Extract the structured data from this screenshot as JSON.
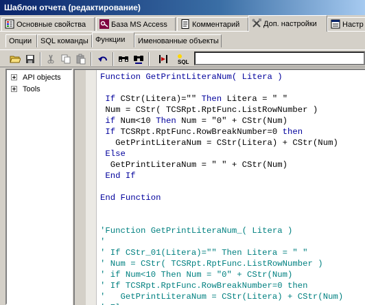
{
  "window": {
    "title": "Шаблон отчета (редактирование)"
  },
  "tabs_main": [
    {
      "label": "Основные свойства",
      "icon": "properties-icon"
    },
    {
      "label": "База MS Access",
      "icon": "database-key-icon"
    },
    {
      "label": "Комментарий",
      "icon": "comment-page-icon"
    },
    {
      "label": "Доп. настройки",
      "icon": "tools-icon"
    },
    {
      "label": "Настр",
      "icon": "settings-page-icon"
    }
  ],
  "tabs_sub": [
    {
      "label": "Опции"
    },
    {
      "label": "SQL команды"
    },
    {
      "label": "Функции"
    },
    {
      "label": "Именованные объекты"
    }
  ],
  "toolbar": {
    "buttons": [
      "open-folder-icon",
      "save-icon",
      "cut-icon",
      "copy-icon",
      "paste-icon",
      "undo-icon",
      "find-icon",
      "find-next-icon",
      "insert-marker-icon",
      "sql-icon"
    ],
    "combo_value": ""
  },
  "tree": {
    "items": [
      {
        "label": "API objects"
      },
      {
        "label": "Tools"
      }
    ]
  },
  "code": {
    "lines": [
      {
        "segments": [
          {
            "t": "Function GetPrintLiteraNum( Litera )",
            "k": "kw"
          }
        ]
      },
      {
        "segments": [
          {
            "t": "",
            "k": ""
          }
        ]
      },
      {
        "segments": [
          {
            "t": " If ",
            "k": "kw"
          },
          {
            "t": "CStr(Litera)=\"\" ",
            "k": ""
          },
          {
            "t": "Then",
            "k": "kw"
          },
          {
            "t": " Litera = \" \"",
            "k": ""
          }
        ]
      },
      {
        "segments": [
          {
            "t": " Num = CStr( TCSRpt.RptFunc.ListRowNumber )",
            "k": ""
          }
        ]
      },
      {
        "segments": [
          {
            "t": " if ",
            "k": "kw"
          },
          {
            "t": "Num<10 ",
            "k": ""
          },
          {
            "t": "Then",
            "k": "kw"
          },
          {
            "t": " Num = \"0\" + CStr(Num)",
            "k": ""
          }
        ]
      },
      {
        "segments": [
          {
            "t": " If ",
            "k": "kw"
          },
          {
            "t": "TCSRpt.RptFunc.RowBreakNumber=0 ",
            "k": ""
          },
          {
            "t": "then",
            "k": "kw"
          }
        ]
      },
      {
        "segments": [
          {
            "t": "   GetPrintLiteraNum = CStr(Litera) + CStr(Num)",
            "k": ""
          }
        ]
      },
      {
        "segments": [
          {
            "t": " Else",
            "k": "kw"
          }
        ]
      },
      {
        "segments": [
          {
            "t": "  GetPrintLiteraNum = \" \" + CStr(Num)",
            "k": ""
          }
        ]
      },
      {
        "segments": [
          {
            "t": " End If",
            "k": "kw"
          }
        ]
      },
      {
        "segments": [
          {
            "t": "",
            "k": ""
          }
        ]
      },
      {
        "segments": [
          {
            "t": "End Function",
            "k": "kw"
          }
        ]
      },
      {
        "segments": [
          {
            "t": "",
            "k": ""
          }
        ]
      },
      {
        "segments": [
          {
            "t": "",
            "k": ""
          }
        ]
      },
      {
        "segments": [
          {
            "t": "'Function GetPrintLiteraNum_( Litera )",
            "k": "cm"
          }
        ]
      },
      {
        "segments": [
          {
            "t": "'",
            "k": "cm"
          }
        ]
      },
      {
        "segments": [
          {
            "t": "' If CStr_01(Litera)=\"\" Then Litera = \" \"",
            "k": "cm"
          }
        ]
      },
      {
        "segments": [
          {
            "t": "' Num = CStr( TCSRpt.RptFunc.ListRowNumber )",
            "k": "cm"
          }
        ]
      },
      {
        "segments": [
          {
            "t": "' if Num<10 Then Num = \"0\" + CStr(Num)",
            "k": "cm"
          }
        ]
      },
      {
        "segments": [
          {
            "t": "' If TCSRpt.RptFunc.RowBreakNumber=0 then",
            "k": "cm"
          }
        ]
      },
      {
        "segments": [
          {
            "t": "'   GetPrintLiteraNum = CStr(Litera) + CStr(Num)",
            "k": "cm"
          }
        ]
      },
      {
        "segments": [
          {
            "t": "' Else",
            "k": "cm"
          }
        ]
      }
    ]
  },
  "colors": {
    "keyword": "#00009c",
    "comment": "#008080",
    "title_bar": "#0a246a"
  }
}
